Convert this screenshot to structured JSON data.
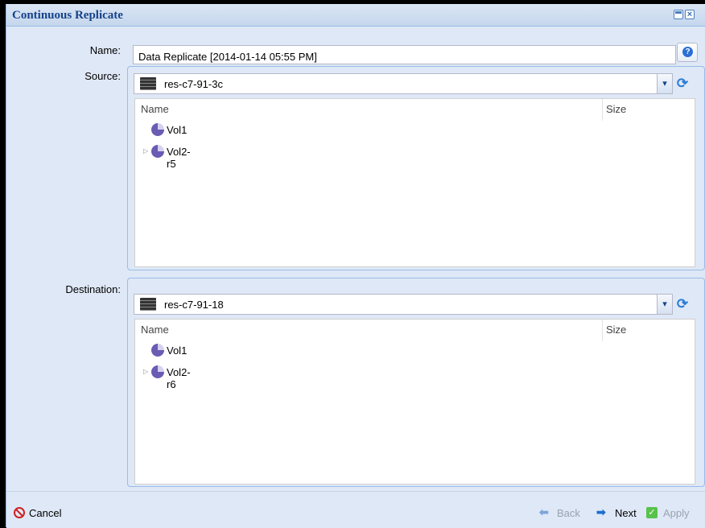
{
  "window": {
    "title": "Continuous Replicate"
  },
  "form": {
    "name_label": "Name:",
    "name_value": "Data Replicate [2014-01-14 05:55 PM]",
    "source_label": "Source:",
    "destination_label": "Destination:"
  },
  "source": {
    "server": "res-c7-91-3c",
    "columns": [
      "Name",
      "Size"
    ],
    "volumes": [
      {
        "name": "Vol1",
        "expandable": false
      },
      {
        "name": "Vol2-r5",
        "expandable": true
      }
    ]
  },
  "destination": {
    "server": "res-c7-91-18",
    "columns": [
      "Name",
      "Size"
    ],
    "volumes": [
      {
        "name": "Vol1",
        "expandable": false
      },
      {
        "name": "Vol2-r6",
        "expandable": true
      }
    ]
  },
  "footer": {
    "cancel_label": "Cancel",
    "back_label": "Back",
    "next_label": "Next",
    "apply_label": "Apply"
  },
  "icons": {
    "help": "help-icon",
    "server": "server-icon",
    "volume": "volume-icon",
    "refresh": "refresh-icon",
    "cancel": "cancel-icon"
  },
  "colors": {
    "title": "#15428b",
    "panel_bg": "#dfe8f6",
    "border": "#99bbe8"
  }
}
